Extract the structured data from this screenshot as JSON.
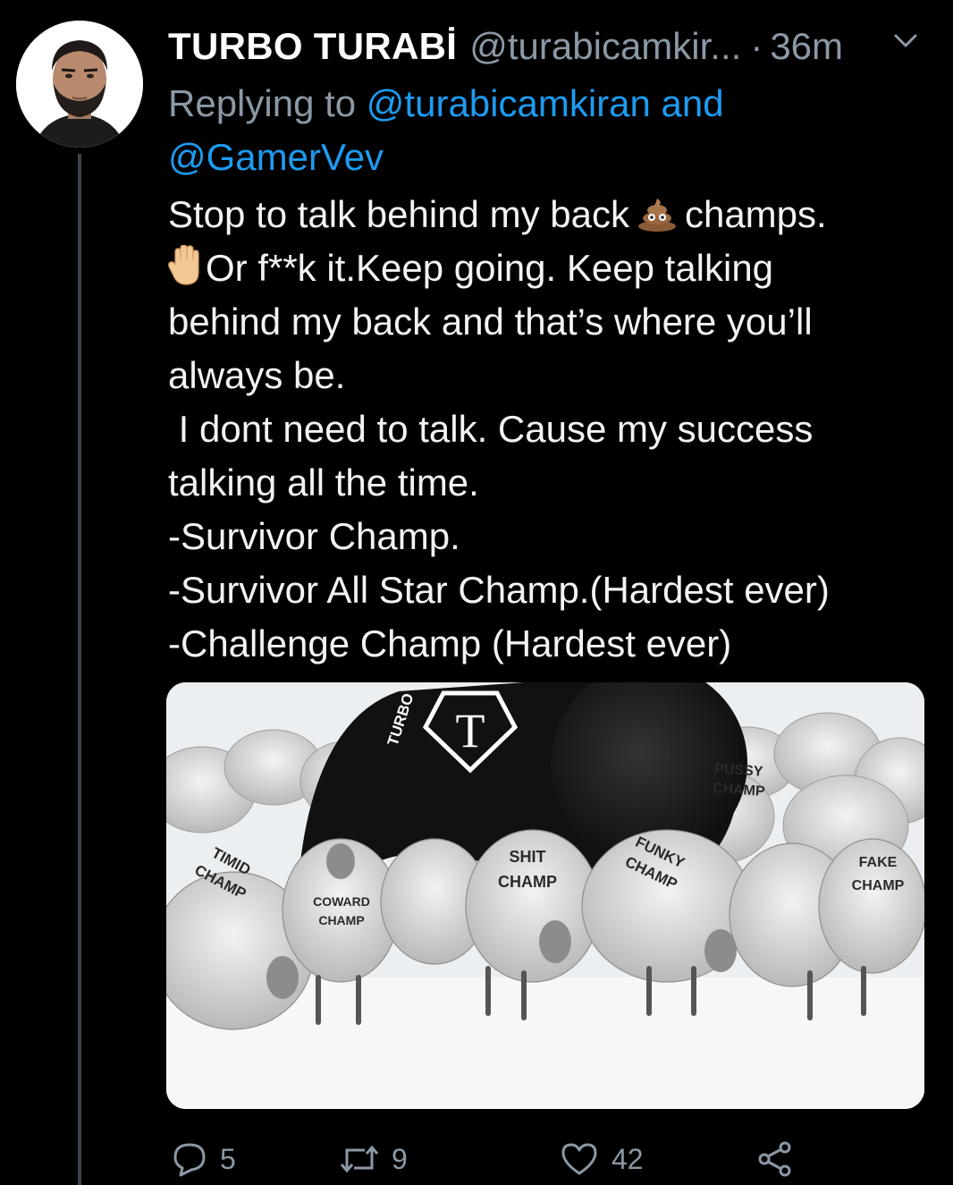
{
  "tweet": {
    "display_name": "TURBO TURABİ",
    "handle": "@turabicamkir...",
    "separator": "·",
    "time": "36m",
    "reply_prefix": "Replying to ",
    "reply_mention_1": "@turabicamkiran",
    "reply_and": " and",
    "reply_mention_2": "@GamerVev",
    "body": {
      "line1_a": "Stop to talk behind my back",
      "line1_emoji": "poop-emoji",
      "line1_b": "champs.",
      "line2_emoji": "raised-hand-emoji",
      "line2_text": "Or f**k it.Keep going. Keep talking",
      "line3": "behind my back and that’s where you’ll",
      "line4": "always be.",
      "line5": " I dont need to talk. Cause my success",
      "line6": "talking all the time.",
      "line7": "-Survivor Champ.",
      "line8": "-Survivor All Star Champ.(Hardest ever)",
      "line9": "-Challenge Champ (Hardest ever)"
    },
    "media": {
      "icon": "lion-among-sheep-image",
      "labels": {
        "turbo": "TURBO",
        "logo_letter": "T",
        "pussy_1": "PUSSY",
        "pussy_2": "CHAMP",
        "timid_1": "TIMID",
        "timid_2": "CHAMP",
        "coward_1": "COWARD",
        "coward_2": "CHAMP",
        "shit_1": "SHIT",
        "shit_2": "CHAMP",
        "funky_1": "FUNKY",
        "funky_2": "CHAMP",
        "fake_1": "FAKE",
        "fake_2": "CHAMP"
      }
    },
    "actions": {
      "reply_count": "5",
      "retweet_count": "9",
      "like_count": "42",
      "reply_icon": "reply-icon",
      "retweet_icon": "retweet-icon",
      "like_icon": "heart-icon",
      "share_icon": "share-icon"
    },
    "colors": {
      "background": "#000000",
      "text": "#e7e9ea",
      "muted": "#8b98a5",
      "link": "#1d9bf0",
      "thread_line": "#3c4349"
    }
  }
}
